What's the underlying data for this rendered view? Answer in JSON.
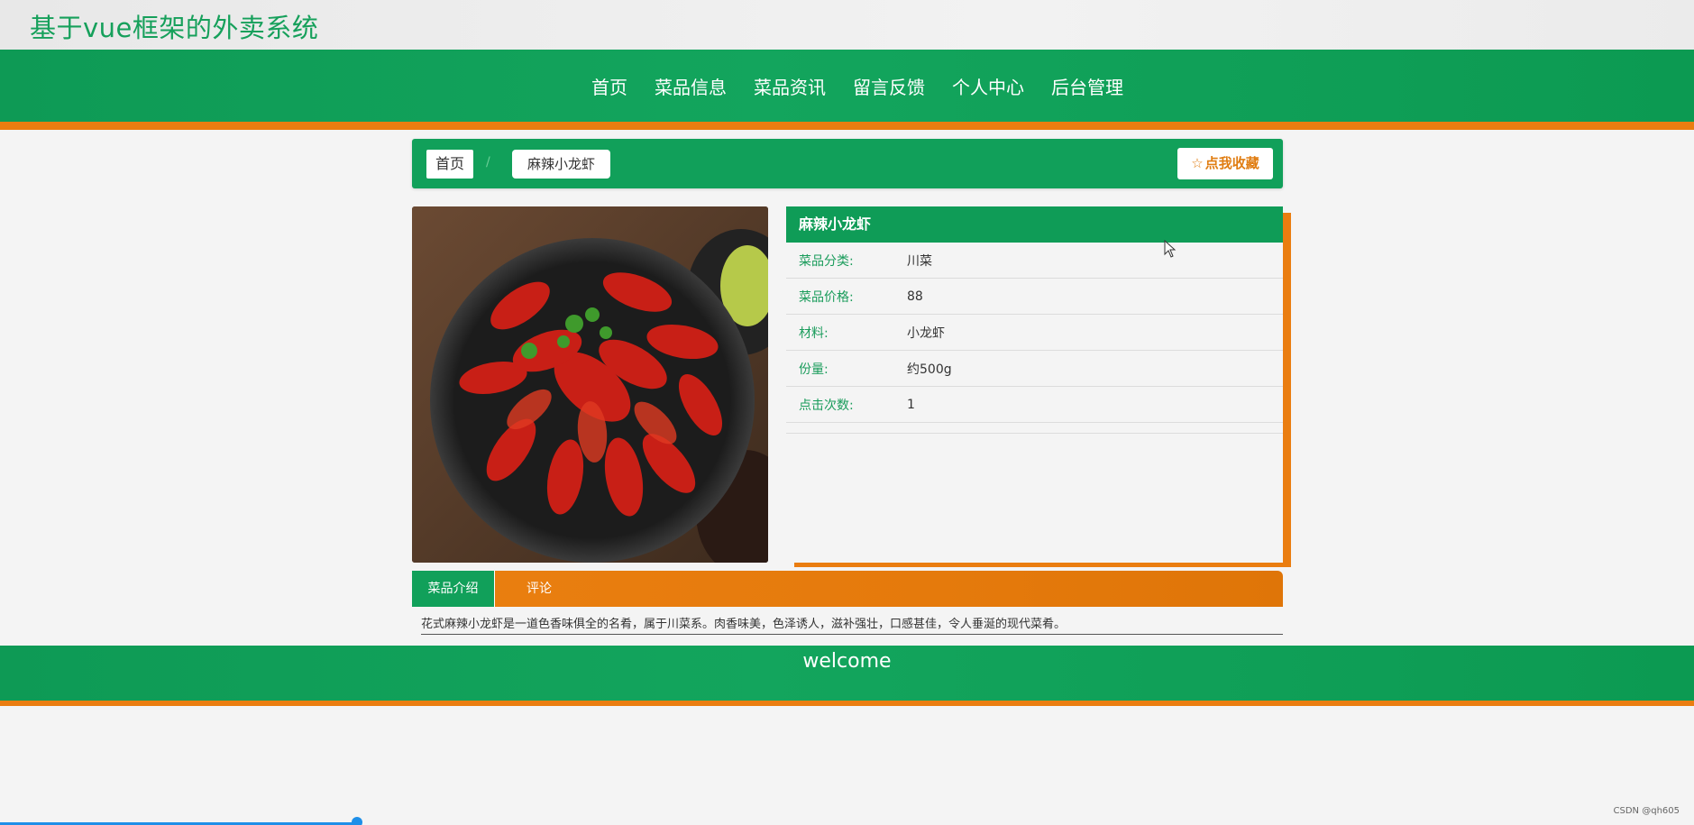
{
  "site": {
    "title": "基于vue框架的外卖系统"
  },
  "nav": {
    "items": [
      {
        "label": "首页"
      },
      {
        "label": "菜品信息"
      },
      {
        "label": "菜品资讯"
      },
      {
        "label": "留言反馈"
      },
      {
        "label": "个人中心"
      },
      {
        "label": "后台管理"
      }
    ]
  },
  "breadcrumb": {
    "home": "首页",
    "separator": "/",
    "current": "麻辣小龙虾"
  },
  "favorite": {
    "label": "点我收藏",
    "icon": "star-outline-icon"
  },
  "dish": {
    "name": "麻辣小龙虾",
    "fields": [
      {
        "label": "菜品分类:",
        "value": "川菜"
      },
      {
        "label": "菜品价格:",
        "value": "88"
      },
      {
        "label": "材料:",
        "value": "小龙虾"
      },
      {
        "label": "份量:",
        "value": "约500g"
      },
      {
        "label": "点击次数:",
        "value": "1"
      }
    ]
  },
  "tabs": {
    "intro": "菜品介绍",
    "comment": "评论"
  },
  "description": "花式麻辣小龙虾是一道色香味俱全的名肴，属于川菜系。肉香味美，色泽诱人，滋补强壮，口感甚佳，令人垂涎的现代菜肴。",
  "footer": {
    "text": "welcome"
  },
  "watermark": "CSDN @qh605",
  "colors": {
    "primary": "#11a05a",
    "accent": "#ea7d10",
    "title": "#16a05b"
  }
}
